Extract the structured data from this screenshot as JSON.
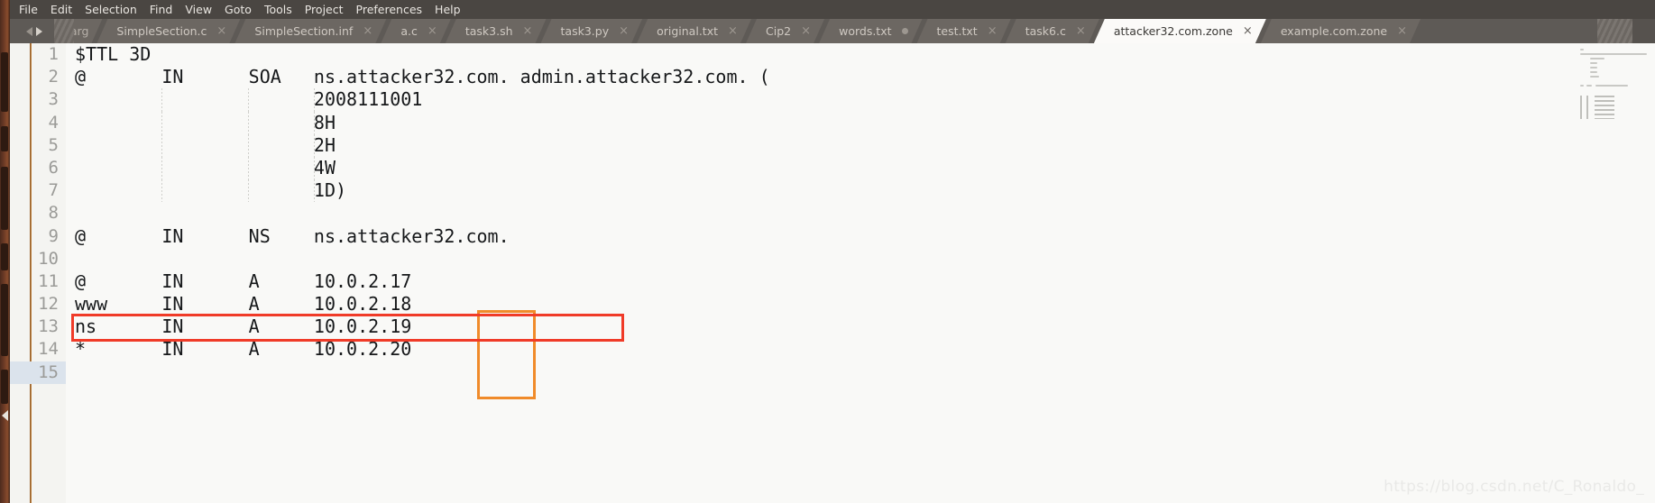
{
  "app": {
    "name": "Sublime Text",
    "watermark": "https://blog.csdn.net/C_Ronaldo_"
  },
  "menubar": {
    "items": [
      {
        "label": "File"
      },
      {
        "label": "Edit"
      },
      {
        "label": "Selection"
      },
      {
        "label": "Find"
      },
      {
        "label": "View"
      },
      {
        "label": "Goto"
      },
      {
        "label": "Tools"
      },
      {
        "label": "Project"
      },
      {
        "label": "Preferences"
      },
      {
        "label": "Help"
      }
    ]
  },
  "tabbar": {
    "nav_prev_icon": "chevron-left-icon",
    "nav_next_icon": "chevron-right-icon",
    "tabs": [
      {
        "label": "targ",
        "close": "",
        "state": "partial",
        "active": false,
        "dirty": false
      },
      {
        "label": "SimpleSection.c",
        "close": "×",
        "state": "normal",
        "active": false,
        "dirty": false
      },
      {
        "label": "SimpleSection.inf",
        "close": "×",
        "state": "normal",
        "active": false,
        "dirty": false
      },
      {
        "label": "a.c",
        "close": "×",
        "state": "normal",
        "active": false,
        "dirty": false
      },
      {
        "label": "task3.sh",
        "close": "×",
        "state": "normal",
        "active": false,
        "dirty": false
      },
      {
        "label": "task3.py",
        "close": "×",
        "state": "normal",
        "active": false,
        "dirty": false
      },
      {
        "label": "original.txt",
        "close": "×",
        "state": "normal",
        "active": false,
        "dirty": false
      },
      {
        "label": "Cip2",
        "close": "×",
        "state": "normal",
        "active": false,
        "dirty": false
      },
      {
        "label": "words.txt",
        "close": "",
        "state": "normal",
        "active": false,
        "dirty": true
      },
      {
        "label": "test.txt",
        "close": "×",
        "state": "normal",
        "active": false,
        "dirty": false
      },
      {
        "label": "task6.c",
        "close": "×",
        "state": "normal",
        "active": false,
        "dirty": false
      },
      {
        "label": "attacker32.com.zone",
        "close": "×",
        "state": "normal",
        "active": true,
        "dirty": false
      },
      {
        "label": "example.com.zone",
        "close": "×",
        "state": "normal",
        "active": false,
        "dirty": false
      }
    ]
  },
  "editor": {
    "filename": "attacker32.com.zone",
    "current_line": 15,
    "lines": [
      {
        "no": "1",
        "text": "$TTL 3D"
      },
      {
        "no": "2",
        "text": "@       IN      SOA   ns.attacker32.com. admin.attacker32.com. ("
      },
      {
        "no": "3",
        "text": "                      2008111001"
      },
      {
        "no": "4",
        "text": "                      8H"
      },
      {
        "no": "5",
        "text": "                      2H"
      },
      {
        "no": "6",
        "text": "                      4W"
      },
      {
        "no": "7",
        "text": "                      1D)"
      },
      {
        "no": "8",
        "text": ""
      },
      {
        "no": "9",
        "text": "@       IN      NS    ns.attacker32.com."
      },
      {
        "no": "10",
        "text": ""
      },
      {
        "no": "11",
        "text": "@       IN      A     10.0.2.17"
      },
      {
        "no": "12",
        "text": "www     IN      A     10.0.2.18"
      },
      {
        "no": "13",
        "text": "ns      IN      A     10.0.2.19"
      },
      {
        "no": "14",
        "text": "*       IN      A     10.0.2.20"
      },
      {
        "no": "15",
        "text": ""
      }
    ]
  },
  "annotations": {
    "orange_box": {
      "color": "#f08b2a",
      "label": "last-octet-highlight",
      "covers": "10.0.2.x last octets on lines 11-14"
    },
    "red_box": {
      "color": "#f03b28",
      "label": "ns-record-highlight",
      "covers": "line 13: ns IN A 10.0.2.19"
    }
  }
}
